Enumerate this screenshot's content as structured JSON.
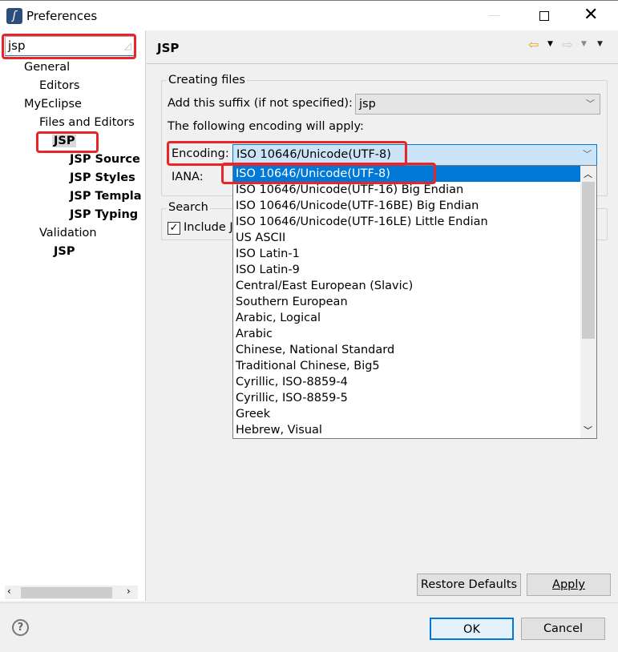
{
  "window": {
    "title": "Preferences"
  },
  "filter": {
    "value": "jsp"
  },
  "tree": [
    {
      "label": "General",
      "indent": 0,
      "bold": false
    },
    {
      "label": "Editors",
      "indent": 1,
      "bold": false
    },
    {
      "label": "MyEclipse",
      "indent": 0,
      "bold": false
    },
    {
      "label": "Files and Editors",
      "indent": 1,
      "bold": false
    },
    {
      "label": "JSP",
      "indent": 2,
      "bold": true,
      "selected": true
    },
    {
      "label": "JSP Source",
      "indent": 3,
      "bold": true
    },
    {
      "label": "JSP Styles",
      "indent": 3,
      "bold": true
    },
    {
      "label": "JSP Templa",
      "indent": 3,
      "bold": true
    },
    {
      "label": "JSP Typing",
      "indent": 3,
      "bold": true
    },
    {
      "label": "Validation",
      "indent": 1,
      "bold": false
    },
    {
      "label": "JSP",
      "indent": 2,
      "bold": true
    }
  ],
  "page": {
    "title": "JSP",
    "creating_group": "Creating files",
    "suffix_label": "Add this suffix (if not specified):",
    "suffix_value": "jsp",
    "encoding_note": "The following encoding will apply:",
    "encoding_label": "Encoding:",
    "encoding_value": "ISO 10646/Unicode(UTF-8)",
    "iana_label": "IANA:",
    "search_group": "Search",
    "include_label": "Include J",
    "include_checked": true
  },
  "encoding_options": [
    "ISO 10646/Unicode(UTF-8)",
    "ISO 10646/Unicode(UTF-16) Big Endian",
    "ISO 10646/Unicode(UTF-16BE) Big Endian",
    "ISO 10646/Unicode(UTF-16LE) Little Endian",
    "US ASCII",
    "ISO Latin-1",
    "ISO Latin-9",
    "Central/East European (Slavic)",
    "Southern European",
    "Arabic, Logical",
    "Arabic",
    "Chinese, National Standard",
    "Traditional Chinese, Big5",
    "Cyrillic, ISO-8859-4",
    "Cyrillic, ISO-8859-5",
    "Greek",
    "Hebrew, Visual"
  ],
  "buttons": {
    "restore": "Restore Defaults",
    "apply": "Apply",
    "ok": "OK",
    "cancel": "Cancel"
  },
  "colors": {
    "selection": "#0078d7",
    "highlight": "#e8262a"
  }
}
